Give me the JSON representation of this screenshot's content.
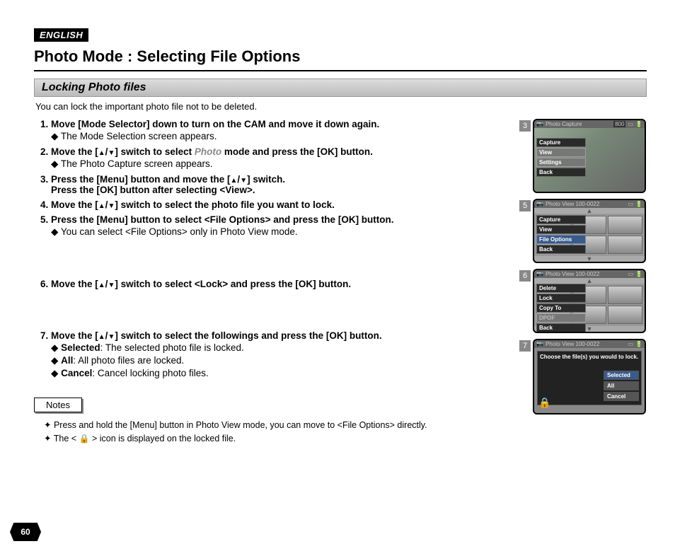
{
  "lang_badge": "ENGLISH",
  "title": "Photo Mode : Selecting File Options",
  "section": "Locking Photo files",
  "intro": "You can lock the important photo file not to be deleted.",
  "steps": {
    "s1": {
      "main_a": "Move [Mode Selector] down to turn on the CAM and move it down again.",
      "sub": "The Mode Selection screen appears."
    },
    "s2": {
      "main_a": "Move the [",
      "main_b": "] switch to select ",
      "mode": "Photo",
      "main_c": " mode and press the [OK] button.",
      "sub": "The Photo Capture screen appears."
    },
    "s3": {
      "line1_a": "Press the [Menu] button and move the [",
      "line1_b": "] switch.",
      "line2": "Press the [OK] button after selecting <View>."
    },
    "s4": {
      "main_a": "Move the [",
      "main_b": "] switch to select the photo file you want to lock."
    },
    "s5": {
      "main": "Press the [Menu] button to select <File Options> and press the [OK] button.",
      "sub": "You can select <File Options> only in Photo View mode."
    },
    "s6": {
      "main_a": "Move the [",
      "main_b": "] switch to select <Lock> and press the [OK] button."
    },
    "s7": {
      "main_a": "Move the [",
      "main_b": "] switch to select the followings and press the [OK] button.",
      "opt1_label": "Selected",
      "opt1_text": ": The selected photo file is locked.",
      "opt2_label": "All",
      "opt2_text": ": All photo files are locked.",
      "opt3_label": "Cancel",
      "opt3_text": ": Cancel locking photo files."
    }
  },
  "notes_label": "Notes",
  "notes": {
    "n1": "Press and hold the [Menu] button in Photo View mode, you can move to <File Options> directly.",
    "n2_a": "The < ",
    "n2_b": " > icon is displayed on the locked file."
  },
  "page_number": "60",
  "figures": {
    "f3": {
      "num": "3",
      "head": "Photo Capture",
      "badge": "800",
      "menu": [
        "Capture",
        "View",
        "Settings",
        "Back"
      ],
      "selected_idx": 0
    },
    "f5": {
      "num": "5",
      "head": "Photo View 100-0022",
      "menu": [
        "Capture",
        "View",
        "File Options",
        "Back"
      ],
      "selected_idx": 2
    },
    "f6": {
      "num": "6",
      "head": "Photo View 100-0022",
      "menu": [
        "Delete",
        "Lock",
        "Copy To",
        "DPOF",
        "Back"
      ],
      "selected_idx": 1,
      "disabled_idx": 3
    },
    "f7": {
      "num": "7",
      "head": "Photo View 100-0022",
      "dialog": "Choose the file(s) you would to lock.",
      "options": [
        "Selected",
        "All",
        "Cancel"
      ],
      "selected_idx": 0
    }
  }
}
